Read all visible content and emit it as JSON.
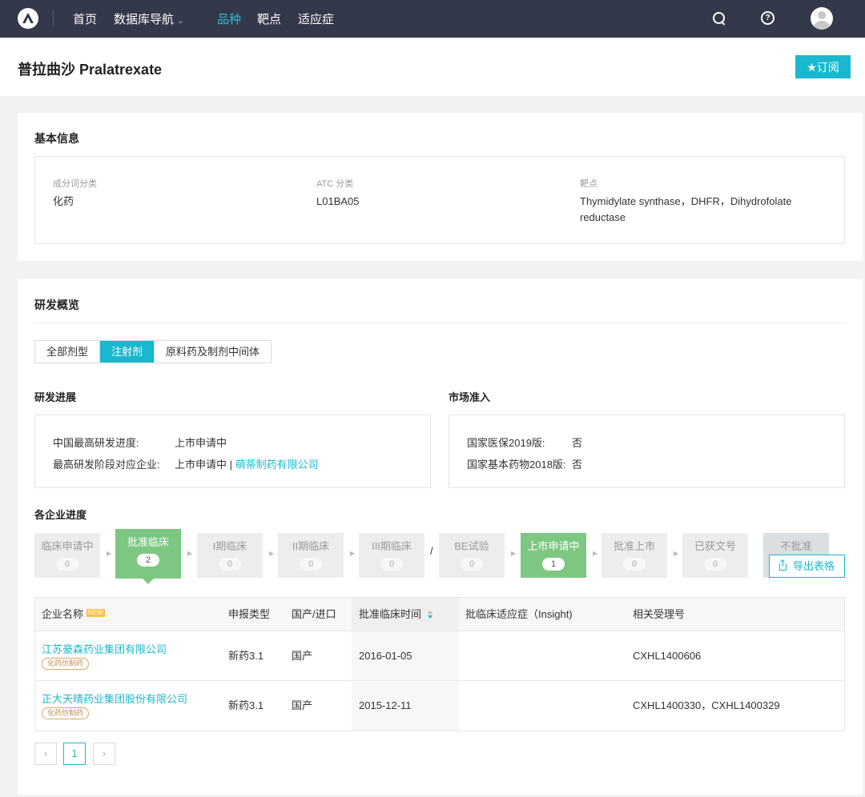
{
  "nav": {
    "items": [
      "首页",
      "数据库导航",
      "品种",
      "靶点",
      "适应症"
    ],
    "dropdown_caret": "⌄",
    "help_glyph": "?"
  },
  "page": {
    "title": "普拉曲沙 Pralatrexate",
    "subscribe_label": "★订阅"
  },
  "basic_info": {
    "title": "基本信息",
    "fields": [
      {
        "label": "成分词分类",
        "value": "化药"
      },
      {
        "label": "ATC 分类",
        "value": "L01BA05"
      },
      {
        "label": "靶点",
        "value": "Thymidylate synthase，DHFR，Dihydrofolate reductase"
      }
    ]
  },
  "rd_overview": {
    "title": "研发概览",
    "tabs": [
      {
        "label": "全部剂型",
        "active": false
      },
      {
        "label": "注射剂",
        "active": true
      },
      {
        "label": "原料药及制剂中间体",
        "active": false
      }
    ],
    "progress": {
      "title": "研发进展",
      "china_top_label": "中国最高研发进度:",
      "china_top_value": "上市申请中",
      "top_company_label": "最高研发阶段对应企业:",
      "top_company_stage": "上市申请中",
      "separator": "|",
      "top_company_name": "萌蒂制药有限公司"
    },
    "market": {
      "title": "市场准入",
      "items": [
        {
          "label": "国家医保2019版:",
          "value": "否"
        },
        {
          "label": "国家基本药物2018版:",
          "value": "否"
        }
      ]
    },
    "company_progress": {
      "title": "各企业进度",
      "stages": [
        {
          "label": "临床申请中",
          "count": "0",
          "active": false
        },
        {
          "label": "批准临床",
          "count": "2",
          "active": true
        },
        {
          "label": "I期临床",
          "count": "0",
          "active": false
        },
        {
          "label": "II期临床",
          "count": "0",
          "active": false
        },
        {
          "label": "III期临床",
          "count": "0",
          "active": false
        },
        {
          "label": "BE试验",
          "count": "0",
          "active": false
        },
        {
          "label": "上市申请中",
          "count": "1",
          "active": true
        },
        {
          "label": "批准上市",
          "count": "0",
          "active": false
        },
        {
          "label": "已获文号",
          "count": "0",
          "active": false
        },
        {
          "label": "不批准",
          "count": "",
          "active": false
        }
      ],
      "or_separator": "/",
      "export_label": "导出表格"
    },
    "table": {
      "columns": [
        "企业名称",
        "申报类型",
        "国产/进口",
        "批准临床时间",
        "批临床适应症（Insight)",
        "相关受理号"
      ],
      "new_badge": "NEW",
      "rows": [
        {
          "company": "江苏豪森药业集团有限公司",
          "tag": "化药仿制药",
          "type": "新药3.1",
          "origin": "国产",
          "date": "2016-01-05",
          "indication": "",
          "numbers": "CXHL1400606"
        },
        {
          "company": "正大天晴药业集团股份有限公司",
          "tag": "化药仿制药",
          "type": "新药3.1",
          "origin": "国产",
          "date": "2015-12-11",
          "indication": "",
          "numbers": "CXHL1400330，CXHL1400329"
        }
      ]
    },
    "pagination": {
      "prev": "‹",
      "current": "1",
      "next": "›"
    }
  },
  "colors": {
    "nav_bg": "#33384b",
    "accent": "#1ab8ce",
    "stage_active": "#7ec783"
  }
}
